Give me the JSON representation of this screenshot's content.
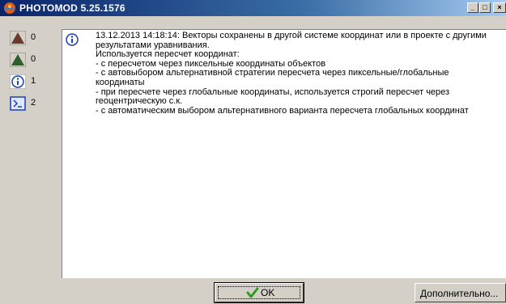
{
  "window": {
    "title": "PHOTOMOD 5.25.1576",
    "minimize_glyph": "_",
    "maximize_glyph": "□",
    "close_glyph": "×"
  },
  "sidebar": {
    "items": [
      {
        "icon": "error-triangle-icon",
        "count": "0"
      },
      {
        "icon": "warning-triangle-icon",
        "count": "0"
      },
      {
        "icon": "info-icon",
        "count": "1"
      },
      {
        "icon": "console-icon",
        "count": "2"
      }
    ]
  },
  "message": {
    "icon": "info-icon",
    "lines": [
      "13.12.2013 14:18:14: Векторы сохранены в другой системе координат или в проекте с другими результатами уравнивания.",
      "Используется пересчет координат:",
      " - с пересчетом через пиксельные координаты объектов",
      " - с автовыбором альтернативной стратегии пересчета через пиксельные/глобальные координаты",
      " - при пересчете через глобальные координаты, используется строгий пересчет через геоцентрическую с.к.",
      " - с автоматическим выбором альтернативного варианта пересчета глобальных координат"
    ]
  },
  "footer": {
    "ok_label": "OK",
    "more_label_first": "Д",
    "more_label_rest": "ополнительно..."
  },
  "colors": {
    "title_gradient_start": "#0a246a",
    "title_gradient_end": "#a6caf0",
    "ok_check": "#2e9e1a"
  }
}
